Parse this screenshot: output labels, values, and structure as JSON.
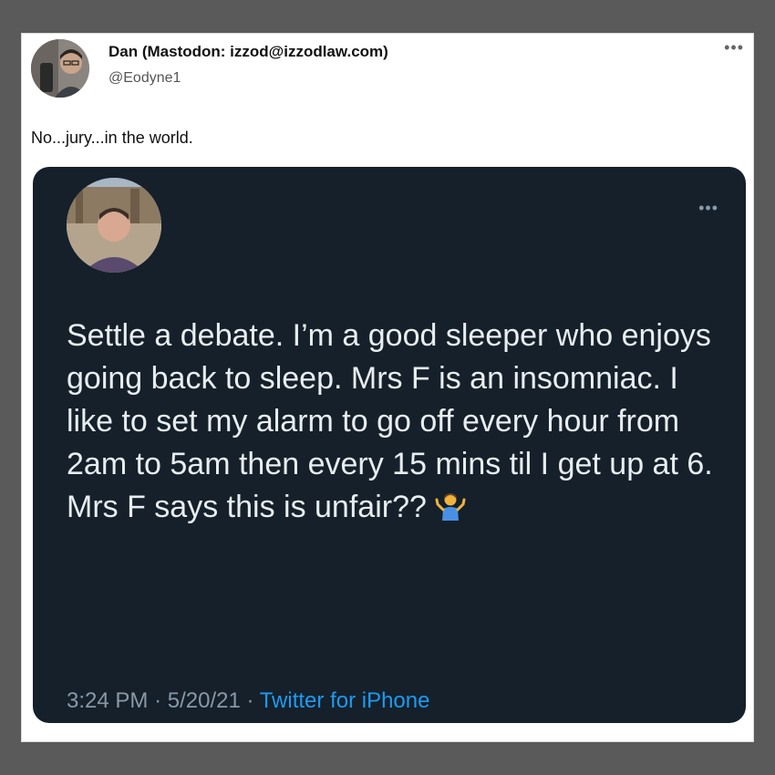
{
  "outer_tweet": {
    "author_name": "Dan (Mastodon: izzod@izzodlaw.com)",
    "author_handle": "@Eodyne1",
    "more_icon": "more-horizontal-icon",
    "text": "No...jury...in the world."
  },
  "quoted_tweet": {
    "more_icon": "more-horizontal-icon",
    "text": "Settle a debate. I’m a good sleeper who enjoys going back to sleep. Mrs F is an insomniac. I like to set my alarm to go off every hour from 2am to 5am then every 15 mins til I get up at 6. Mrs F says this is unfair??",
    "emoji": "person-shrugging-emoji",
    "time": "3:24 PM",
    "separator": "·",
    "date": "5/20/21",
    "source": "Twitter for iPhone"
  },
  "colors": {
    "page_background": "#5a5a5a",
    "card_background": "#15202b",
    "link_blue": "#1d9bf0",
    "muted_text": "#8899a6"
  }
}
